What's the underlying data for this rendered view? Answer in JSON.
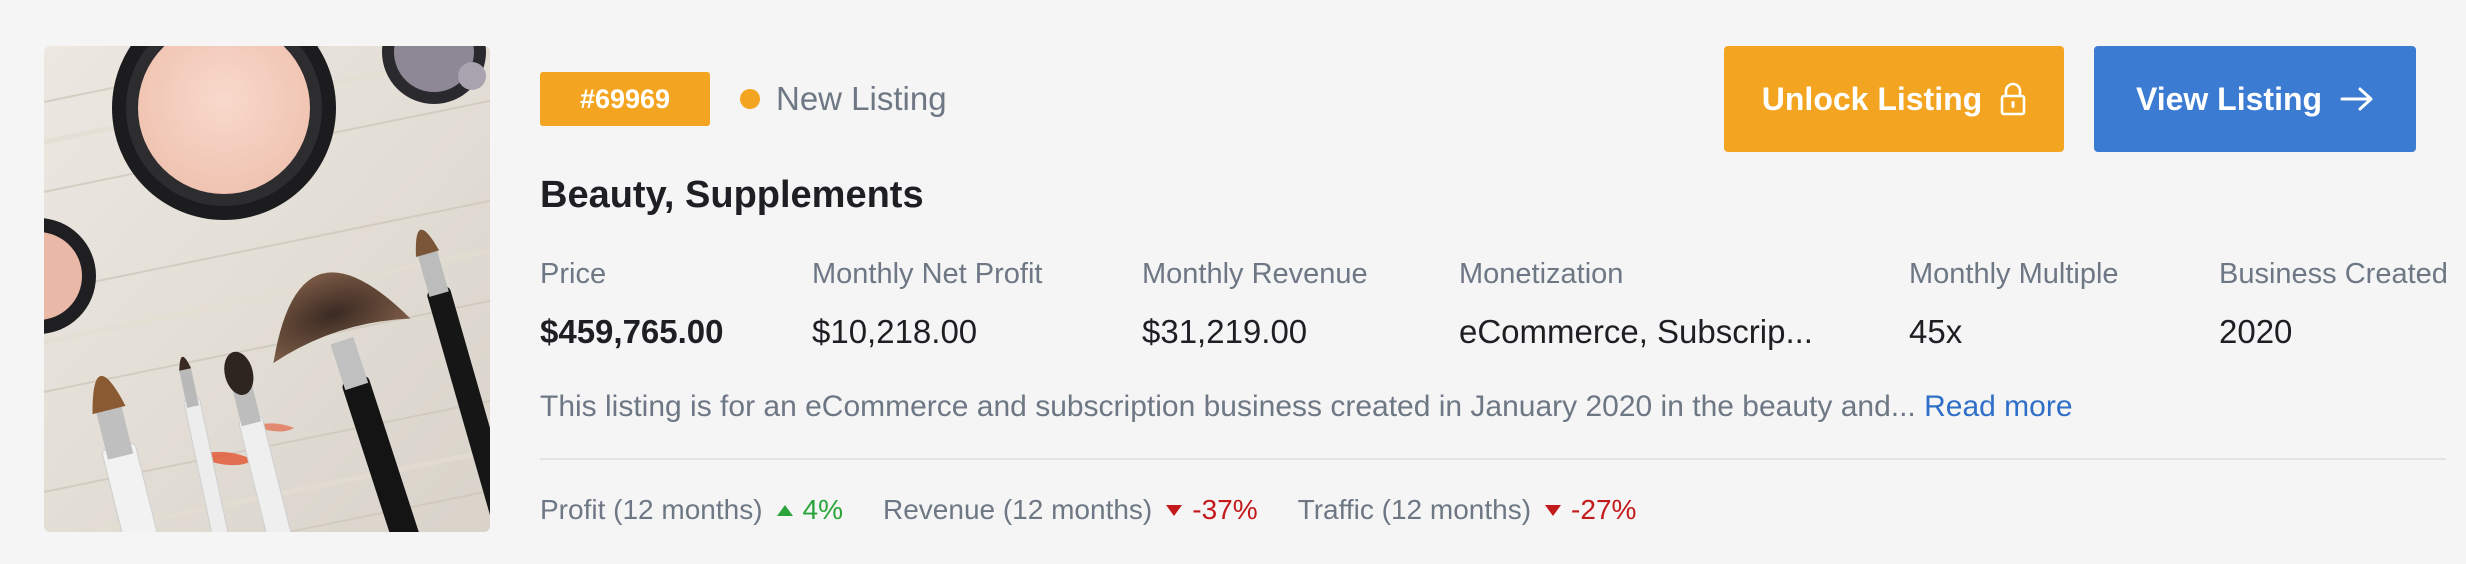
{
  "listing": {
    "id_badge": "#69969",
    "status": "New Listing",
    "title": "Beauty, Supplements",
    "image_icon": "cosmetics-photo"
  },
  "actions": {
    "unlock_label": "Unlock Listing",
    "unlock_icon": "lock-icon",
    "view_label": "View Listing",
    "view_icon": "arrow-right-icon"
  },
  "metrics": [
    {
      "label": "Price",
      "value": "$459,765.00"
    },
    {
      "label": "Monthly Net Profit",
      "value": "$10,218.00"
    },
    {
      "label": "Monthly Revenue",
      "value": "$31,219.00"
    },
    {
      "label": "Monetization",
      "value": "eCommerce, Subscrip..."
    },
    {
      "label": "Monthly Multiple",
      "value": "45x"
    },
    {
      "label": "Business Created",
      "value": "2020"
    }
  ],
  "description": {
    "text": "This listing is for an eCommerce and subscription business created in January 2020 in the beauty and...",
    "read_more": "Read more"
  },
  "trends": [
    {
      "label": "Profit (12 months)",
      "direction": "up",
      "value": "4%"
    },
    {
      "label": "Revenue (12 months)",
      "direction": "down",
      "value": "-37%"
    },
    {
      "label": "Traffic (12 months)",
      "direction": "down",
      "value": "-27%"
    }
  ],
  "colors": {
    "accent_orange": "#f3a521",
    "accent_blue": "#3b7bd2",
    "positive": "#2aa53a",
    "negative": "#c4191b",
    "link": "#2f6fc7"
  }
}
